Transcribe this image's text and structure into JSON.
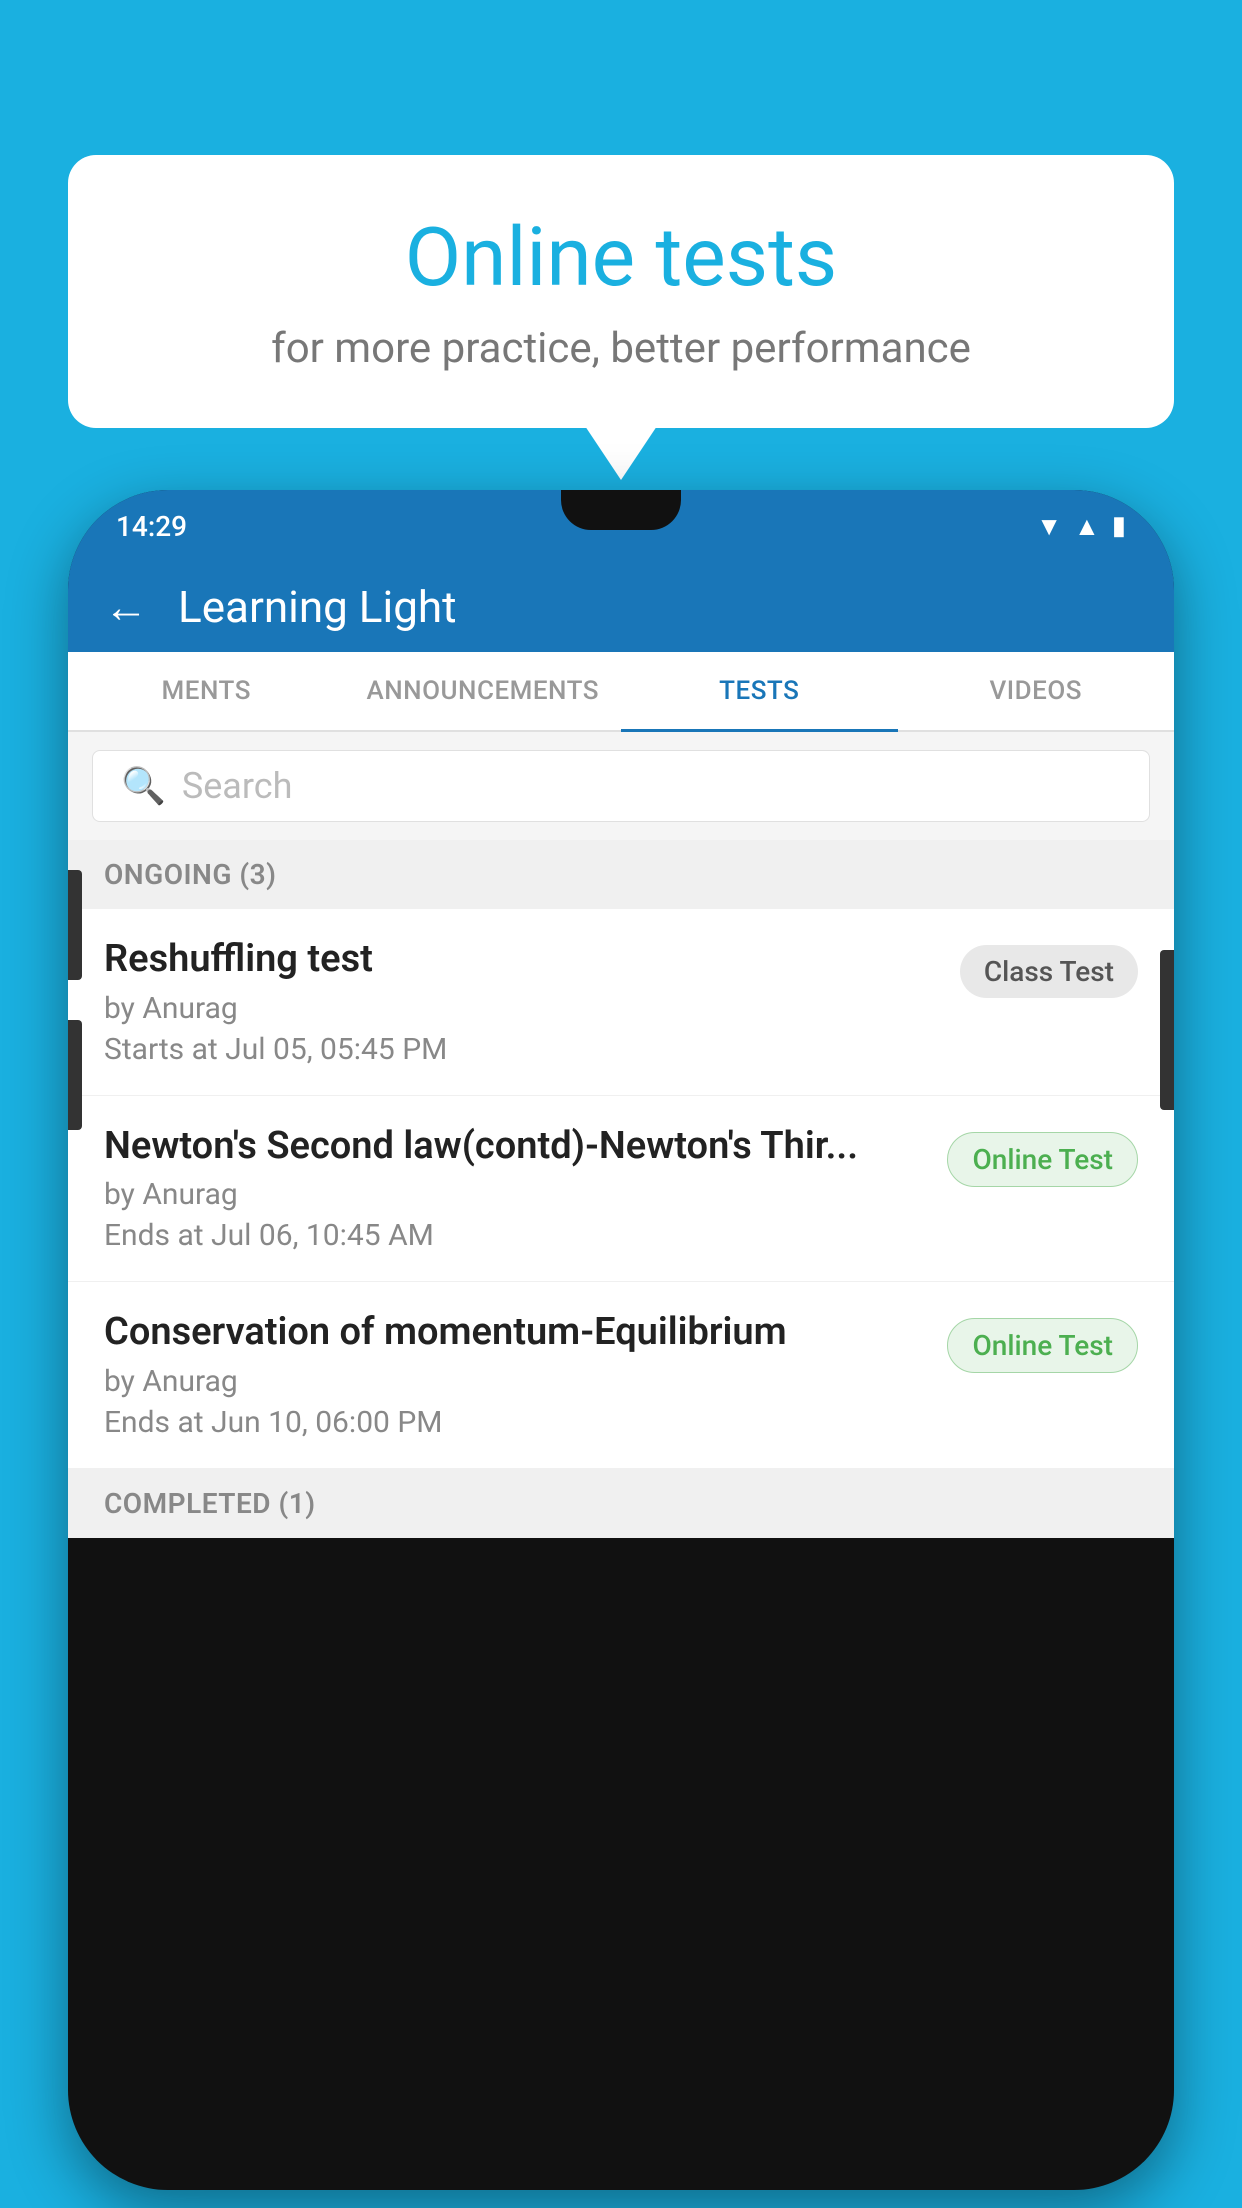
{
  "background_color": "#1ab0e0",
  "speech_bubble": {
    "title": "Online tests",
    "subtitle": "for more practice, better performance"
  },
  "phone": {
    "status_bar": {
      "time": "14:29",
      "icons": [
        "wifi",
        "signal",
        "battery"
      ]
    },
    "header": {
      "back_label": "←",
      "title": "Learning Light"
    },
    "tabs": [
      {
        "label": "MENTS",
        "active": false
      },
      {
        "label": "ANNOUNCEMENTS",
        "active": false
      },
      {
        "label": "TESTS",
        "active": true
      },
      {
        "label": "VIDEOS",
        "active": false
      }
    ],
    "search": {
      "placeholder": "Search"
    },
    "ongoing_section": {
      "label": "ONGOING (3)"
    },
    "tests": [
      {
        "title": "Reshuffling test",
        "by": "by Anurag",
        "date": "Starts at  Jul 05, 05:45 PM",
        "badge": "Class Test",
        "badge_type": "class"
      },
      {
        "title": "Newton's Second law(contd)-Newton's Thir...",
        "by": "by Anurag",
        "date": "Ends at  Jul 06, 10:45 AM",
        "badge": "Online Test",
        "badge_type": "online"
      },
      {
        "title": "Conservation of momentum-Equilibrium",
        "by": "by Anurag",
        "date": "Ends at  Jun 10, 06:00 PM",
        "badge": "Online Test",
        "badge_type": "online"
      }
    ],
    "completed_section": {
      "label": "COMPLETED (1)"
    }
  }
}
